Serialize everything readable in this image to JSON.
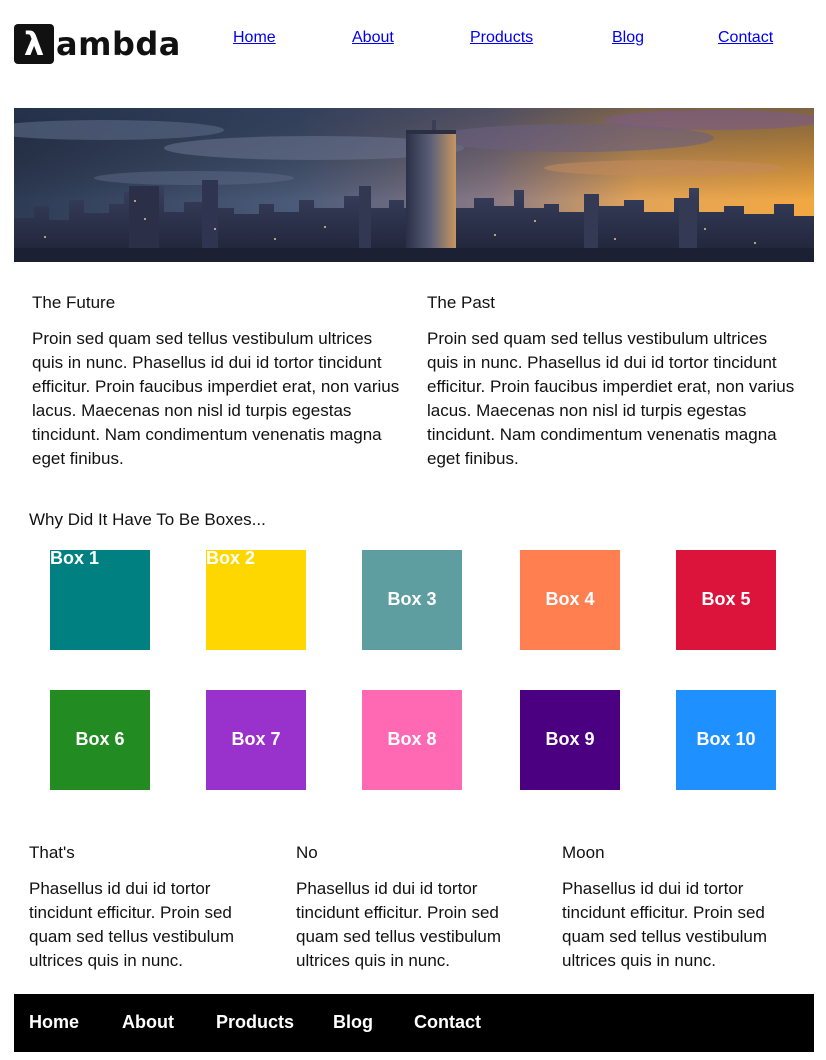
{
  "header": {
    "logo_mark": "λ",
    "logo_text": "ambda",
    "nav": [
      "Home",
      "About",
      "Products",
      "Blog",
      "Contact"
    ]
  },
  "hero": {
    "alt": "City skyline at sunset"
  },
  "sections": {
    "future": {
      "title": "The Future",
      "body": "Proin sed quam sed tellus vestibulum ultrices quis in nunc. Phasellus id dui id tortor tincidunt efficitur. Proin faucibus imperdiet erat, non varius lacus. Maecenas non nisl id turpis egestas tincidunt. Nam condimentum venenatis magna eget finibus."
    },
    "past": {
      "title": "The Past",
      "body": "Proin sed quam sed tellus vestibulum ultrices quis in nunc. Phasellus id dui id tortor tincidunt efficitur. Proin faucibus imperdiet erat, non varius lacus. Maecenas non nisl id turpis egestas tincidunt. Nam condimentum venenatis magna eget finibus."
    }
  },
  "boxes": {
    "title": "Why Did It Have To Be Boxes...",
    "items": [
      {
        "label": "Box 1",
        "color": "#008080"
      },
      {
        "label": "Box 2",
        "color": "#FFD700"
      },
      {
        "label": "Box 3",
        "color": "#5F9EA0"
      },
      {
        "label": "Box 4",
        "color": "#FF7F50"
      },
      {
        "label": "Box 5",
        "color": "#DC143C"
      },
      {
        "label": "Box 6",
        "color": "#228B22"
      },
      {
        "label": "Box 7",
        "color": "#9932CC"
      },
      {
        "label": "Box 8",
        "color": "#FF69B4"
      },
      {
        "label": "Box 9",
        "color": "#4B0082"
      },
      {
        "label": "Box 10",
        "color": "#1E90FF"
      }
    ]
  },
  "bottom": [
    {
      "title": "That's",
      "body": "Phasellus id dui id tortor tincidunt efficitur. Proin sed quam sed tellus vestibulum ultrices quis in nunc."
    },
    {
      "title": "No",
      "body": "Phasellus id dui id tortor tincidunt efficitur. Proin sed quam sed tellus vestibulum ultrices quis in nunc."
    },
    {
      "title": "Moon",
      "body": "Phasellus id dui id tortor tincidunt efficitur. Proin sed quam sed tellus vestibulum ultrices quis in nunc."
    }
  ],
  "footer": {
    "nav": [
      "Home",
      "About",
      "Products",
      "Blog",
      "Contact"
    ]
  }
}
